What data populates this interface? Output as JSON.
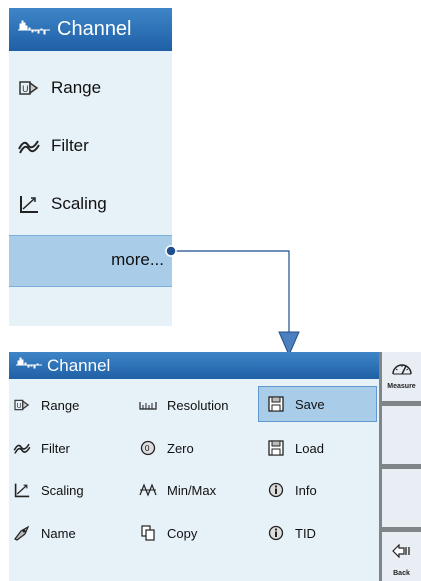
{
  "top_menu": {
    "title": "Channel",
    "items": [
      {
        "label": "Range",
        "icon": "range-icon"
      },
      {
        "label": "Filter",
        "icon": "filter-icon"
      },
      {
        "label": "Scaling",
        "icon": "scaling-icon"
      }
    ],
    "more_label": "more..."
  },
  "bottom_menu": {
    "title": "Channel",
    "columns": [
      [
        {
          "label": "Range",
          "icon": "range-icon"
        },
        {
          "label": "Filter",
          "icon": "filter-icon"
        },
        {
          "label": "Scaling",
          "icon": "scaling-icon"
        },
        {
          "label": "Name",
          "icon": "name-icon"
        }
      ],
      [
        {
          "label": "Resolution",
          "icon": "resolution-icon"
        },
        {
          "label": "Zero",
          "icon": "zero-icon"
        },
        {
          "label": "Min/Max",
          "icon": "minmax-icon"
        },
        {
          "label": "Copy",
          "icon": "copy-icon"
        }
      ],
      [
        {
          "label": "Save",
          "icon": "save-icon",
          "selected": true
        },
        {
          "label": "Load",
          "icon": "load-icon"
        },
        {
          "label": "Info",
          "icon": "info-icon"
        },
        {
          "label": "TID",
          "icon": "info-icon"
        }
      ]
    ]
  },
  "sidebar": {
    "measure_label": "Measure",
    "back_label": "Back"
  },
  "colors": {
    "header": "#2a6fb5",
    "panel": "#e7f1f8",
    "selected": "#a9cce9",
    "connector": "#1f4e8c"
  }
}
